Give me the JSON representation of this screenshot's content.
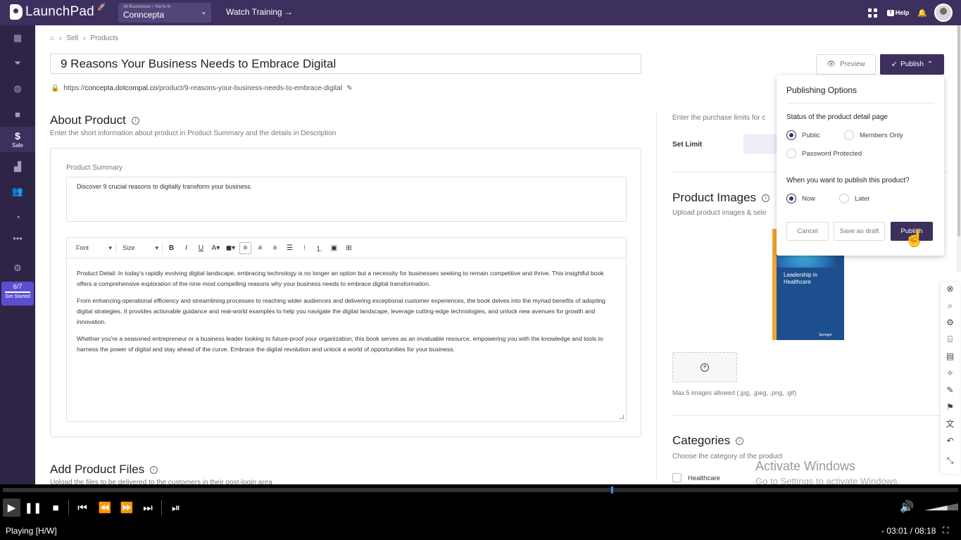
{
  "app": {
    "name": "LaunchPad"
  },
  "header": {
    "biz_crumb": "All Businesses › You're In",
    "biz_name": "Conncepta",
    "watch_training": "Watch Training →",
    "help": "Help"
  },
  "sidebar": {
    "items": [
      {
        "icon": "dashboard-icon"
      },
      {
        "icon": "funnel-icon"
      },
      {
        "icon": "globe-icon"
      },
      {
        "icon": "video-icon"
      },
      {
        "icon": "dollar-icon",
        "label": "Sale"
      },
      {
        "icon": "chart-icon"
      },
      {
        "icon": "people-icon"
      },
      {
        "icon": "speed-icon"
      },
      {
        "icon": "more-icon"
      },
      {
        "icon": "gear-icon"
      }
    ],
    "progress": {
      "count": "6/7",
      "label": "Get Started"
    }
  },
  "breadcrumb": {
    "items": [
      "Sell",
      "Products"
    ]
  },
  "product": {
    "title": "9 Reasons Your Business Needs to Embrace Digital",
    "url_prefix": "https://",
    "url_domain": "concepta.dotcompal.co",
    "url_path": "/product/9-reasons-your-business-needs-to-embrace-digital"
  },
  "about": {
    "title": "About Product",
    "subtitle": "Enter the short information about product in Product Summary and the details in Description",
    "summary_label": "Product Summary",
    "summary_value": "Discover 9 crucial reasons to digitally transform your business.",
    "toolbar": {
      "font": "Font",
      "size": "Size"
    },
    "description": [
      "Product Detail: In today's rapidly evolving digital landscape, embracing technology is no longer an option but a necessity for businesses seeking to remain competitive and thrive. This insightful book offers a comprehensive exploration of the nine most compelling reasons why your business needs to embrace digital transformation.",
      "From enhancing operational efficiency and streamlining processes to reaching wider audiences and delivering exceptional customer experiences, the book delves into the myriad benefits of adopting digital strategies. It provides actionable guidance and real-world examples to help you navigate the digital landscape, leverage cutting-edge technologies, and unlock new avenues for growth and innovation.",
      "Whether you're a seasoned entrepreneur or a business leader looking to future-proof your organization, this book serves as an invaluable resource, empowering you with the knowledge and tools to harness the power of digital and stay ahead of the curve. Embrace the digital revolution and unlock a world of opportunities for your business."
    ]
  },
  "files": {
    "title": "Add Product Files",
    "subtitle": "Upload the files to be delivered to the customers in their post-login area"
  },
  "right": {
    "purchase_limits": "Enter the purchase limits for c",
    "set_limit": "Set Limit",
    "images_title": "Product Images",
    "images_sub": "Upload product images & sele",
    "book_title": "Leadership in Healthcare",
    "book_publisher": "Springer",
    "images_note": "Max 5 images allowed (.jpg, .jpeg, .png, .gif)",
    "categories_title": "Categories",
    "categories_sub": "Choose the category of the product",
    "category_1": "Healthcare"
  },
  "actions": {
    "preview": "Preview",
    "publish": "Publish"
  },
  "publish_popup": {
    "title": "Publishing Options",
    "status_label": "Status of the product detail page",
    "status_options": [
      "Public",
      "Members Only",
      "Password Protected"
    ],
    "status_selected": "Public",
    "when_label": "When you want to publish this product?",
    "when_options": [
      "Now",
      "Later"
    ],
    "when_selected": "Now",
    "cancel": "Cancel",
    "draft": "Save as draft",
    "publish": "Publish"
  },
  "watermark": {
    "line1": "Activate Windows",
    "line2": "Go to Settings to activate Windows."
  },
  "player": {
    "status": "Playing [H/W]",
    "time": "- 03:01 / 08:18",
    "progress": 0.637,
    "volume": 0.68
  },
  "colors": {
    "brand": "#3d2f5e",
    "sidebar": "#2e2546",
    "accent": "#5b4fd0"
  }
}
